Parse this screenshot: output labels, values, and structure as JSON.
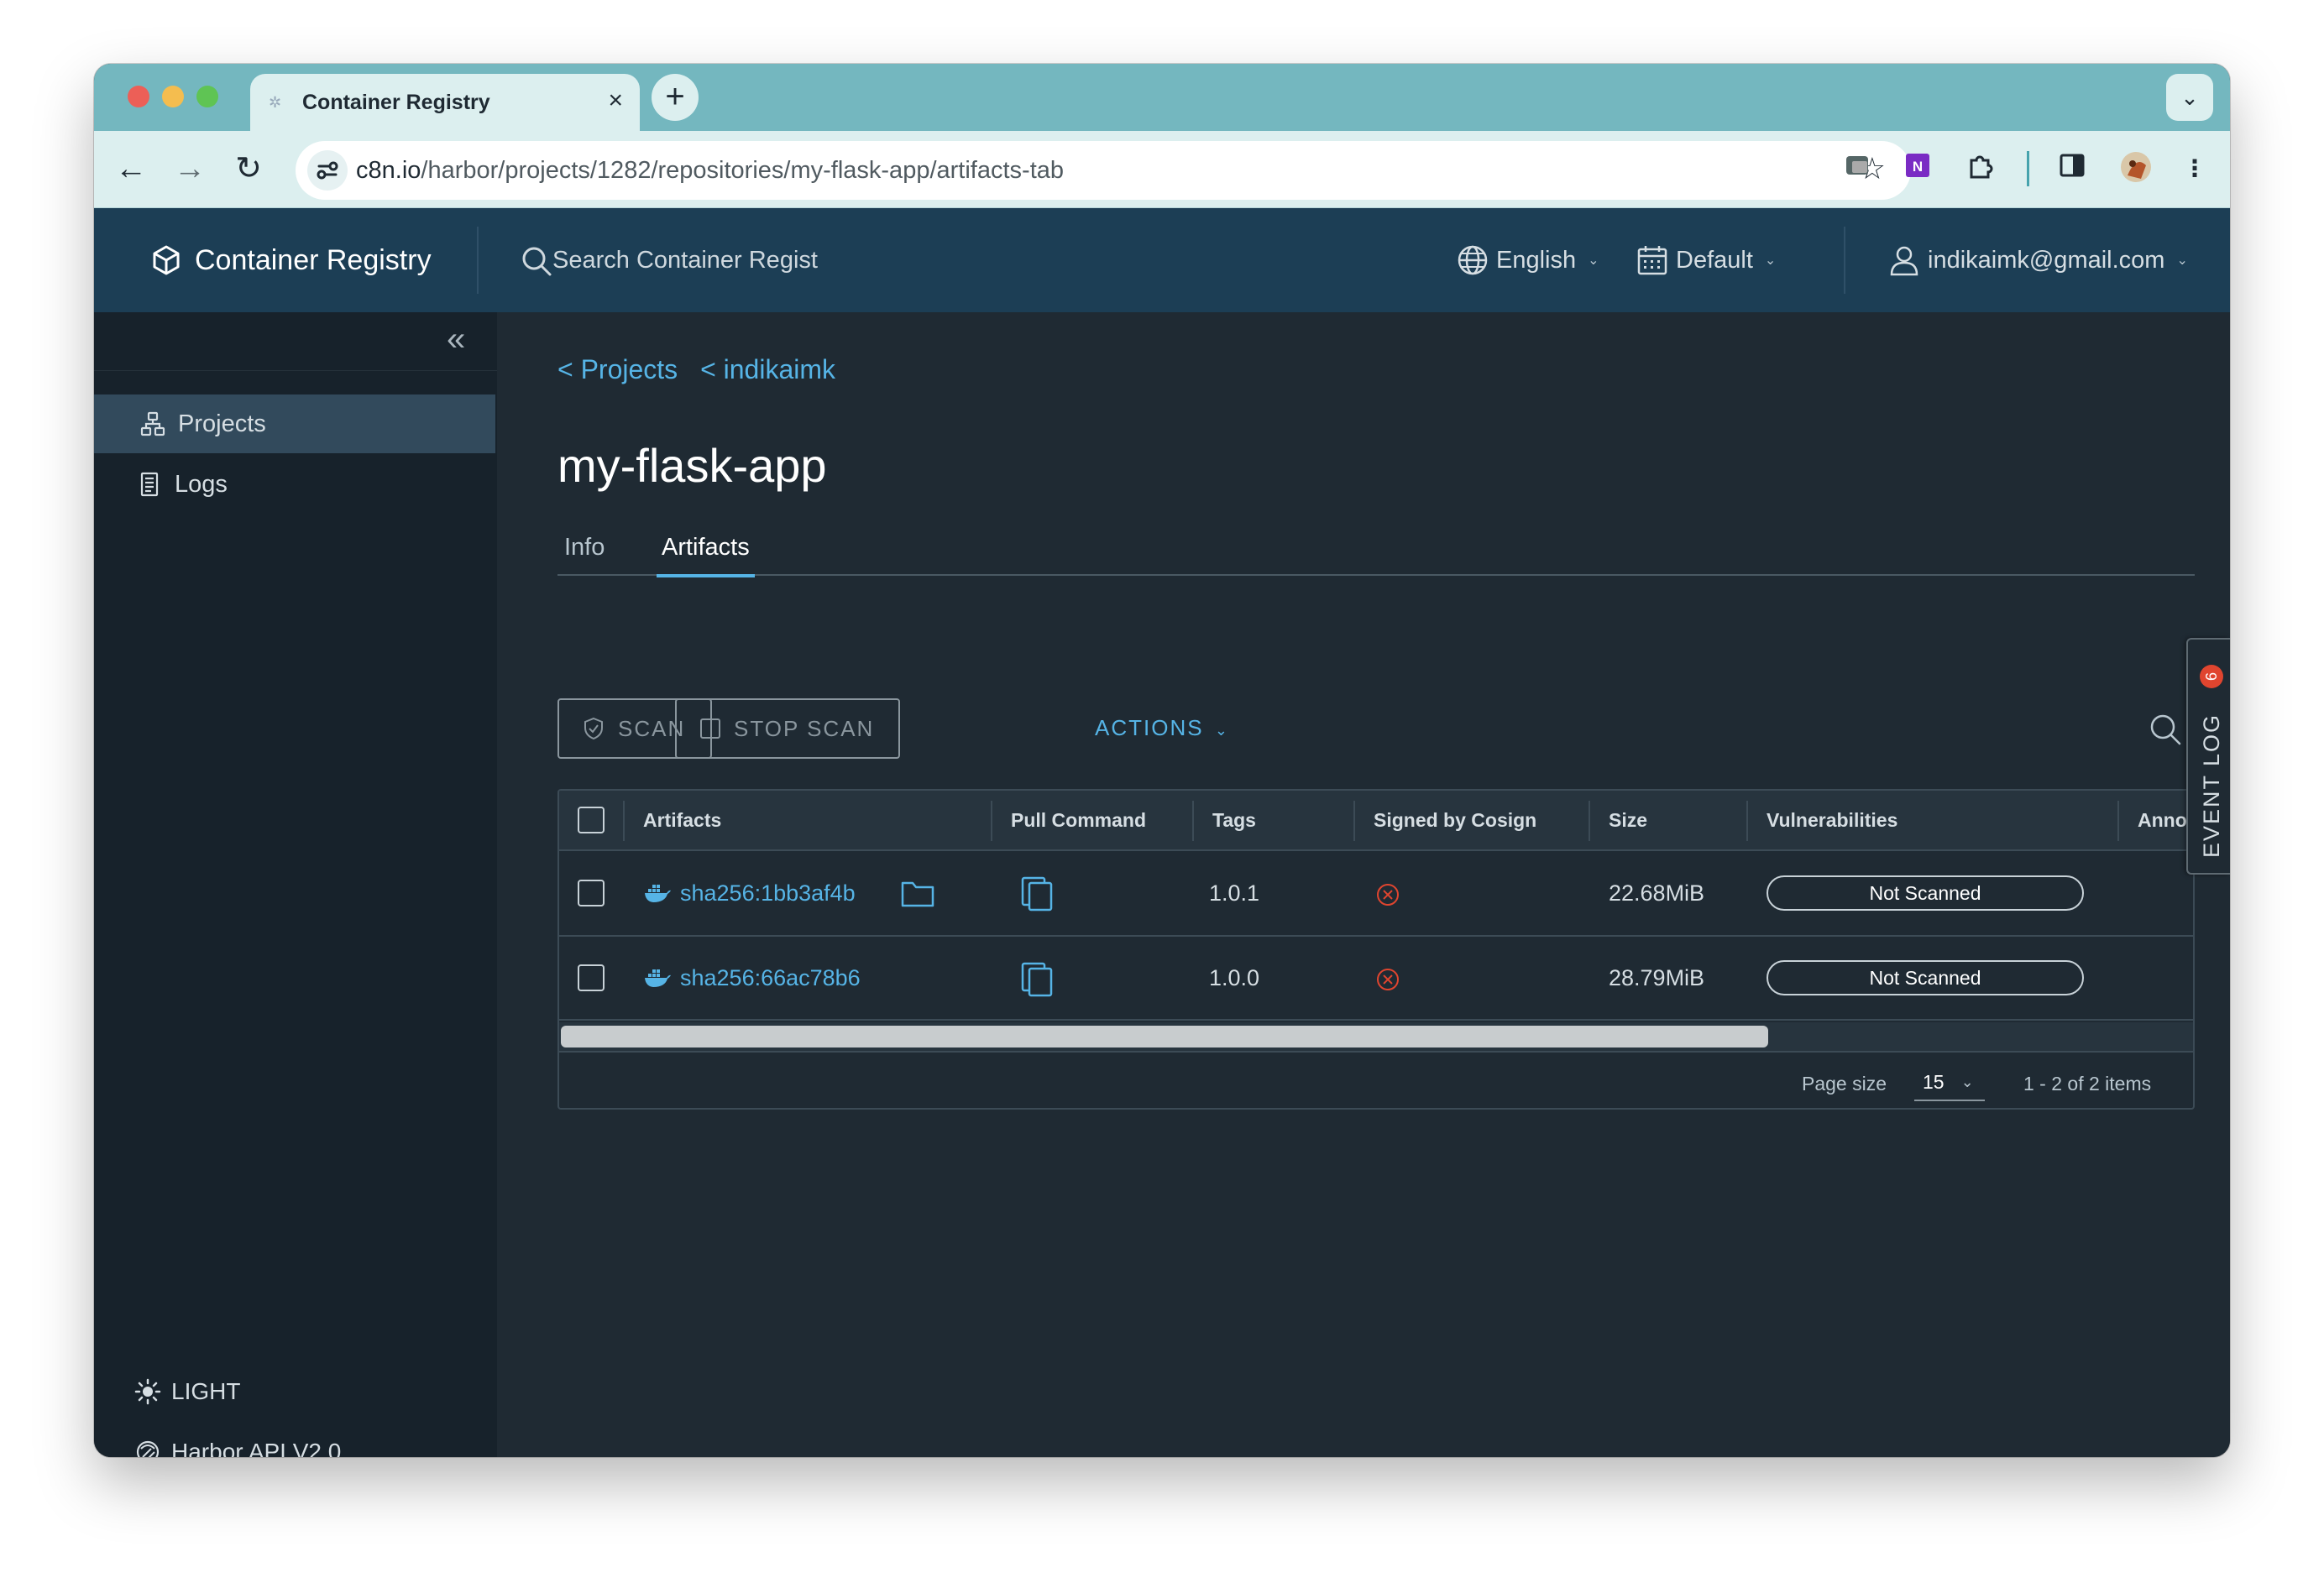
{
  "browser": {
    "tab_title": "Container Registry",
    "url_host": "c8n.io",
    "url_path": "/harbor/projects/1282/repositories/my-flask-app/artifacts-tab"
  },
  "header": {
    "brand": "Container Registry",
    "search_placeholder": "Search Container Regist",
    "language": "English",
    "theme": "Default",
    "user": "indikaimk@gmail.com"
  },
  "sidebar": {
    "items": [
      {
        "label": "Projects",
        "icon": "projects-icon",
        "active": true
      },
      {
        "label": "Logs",
        "icon": "logs-icon",
        "active": false
      }
    ],
    "theme_toggle": "LIGHT",
    "api_link": "Harbor API V2.0"
  },
  "breadcrumb": [
    "< Projects",
    "< indikaimk"
  ],
  "page_title": "my-flask-app",
  "tabs": [
    {
      "label": "Info",
      "active": false
    },
    {
      "label": "Artifacts",
      "active": true
    }
  ],
  "toolbar": {
    "scan": "SCAN",
    "stop_scan": "STOP SCAN",
    "actions": "ACTIONS"
  },
  "grid": {
    "columns": [
      "Artifacts",
      "Pull Command",
      "Tags",
      "Signed by Cosign",
      "Size",
      "Vulnerabilities",
      "Annot"
    ],
    "rows": [
      {
        "artifact": "sha256:1bb3af4b",
        "tags": "1.0.1",
        "signed": false,
        "size": "22.68MiB",
        "vulnerabilities": "Not Scanned"
      },
      {
        "artifact": "sha256:66ac78b6",
        "tags": "1.0.0",
        "signed": false,
        "size": "28.79MiB",
        "vulnerabilities": "Not Scanned"
      }
    ],
    "page_size_label": "Page size",
    "page_size": "15",
    "count": "1 - 2 of 2 items"
  },
  "event_log": {
    "label": "EVENT LOG",
    "count": "6"
  },
  "colors": {
    "header_bg": "#1c3e55",
    "sidebar_bg": "#17222b",
    "content_bg": "#1f2a33",
    "link": "#56b4e6",
    "error": "#e0452f"
  }
}
